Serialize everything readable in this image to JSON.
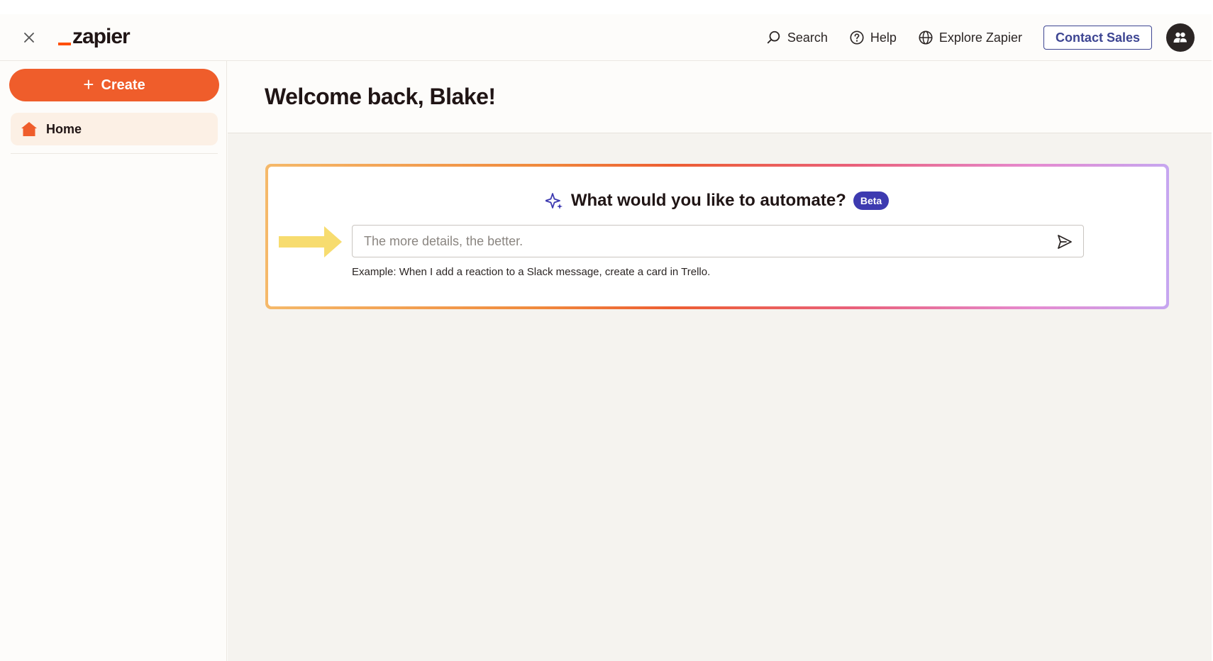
{
  "topbar": {
    "logo_text": "zapier",
    "nav": {
      "search_label": "Search",
      "help_label": "Help",
      "explore_label": "Explore Zapier"
    },
    "contact_sales_label": "Contact Sales"
  },
  "sidebar": {
    "create_label": "Create",
    "items": [
      {
        "label": "Home",
        "icon": "home-icon"
      }
    ]
  },
  "main": {
    "welcome": "Welcome back, Blake!",
    "ai_prompt": {
      "title": "What would you like to automate?",
      "badge": "Beta",
      "placeholder": "The more details, the better.",
      "example": "Example: When I add a reaction to a Slack message, create a card in Trello."
    }
  },
  "colors": {
    "brand_orange": "#ff4f00",
    "create_button": "#ef5d2b",
    "contact_border": "#3d4592",
    "beta_badge": "#3d3ab0",
    "arrow_yellow": "#f7dc6f"
  }
}
